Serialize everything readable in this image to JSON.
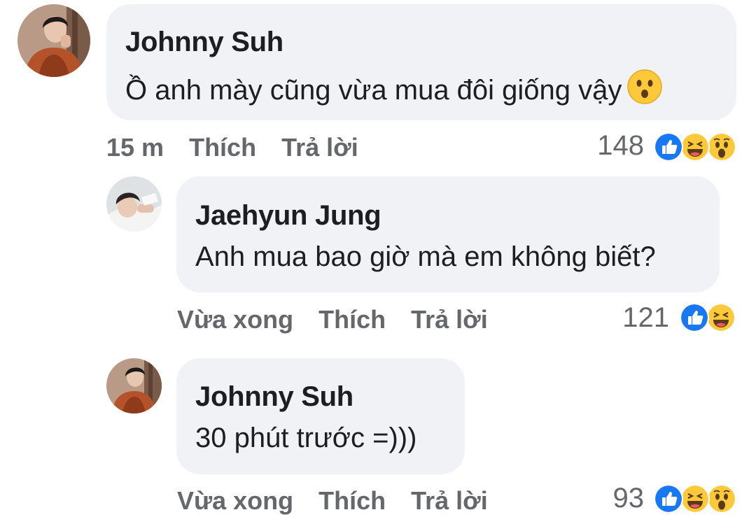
{
  "comments": [
    {
      "author": "Johnny Suh",
      "text": "Ồ anh mày cũng vừa mua đôi giống vậy",
      "inline_emoji": "hushed-face-emoji",
      "time": "15 m",
      "like_label": "Thích",
      "reply_label": "Trả lời",
      "reaction_count": "148",
      "reactions": [
        "like",
        "haha",
        "wow"
      ]
    },
    {
      "author": "Jaehyun Jung",
      "text": "Anh mua bao giờ mà em không biết?",
      "time": "Vừa xong",
      "like_label": "Thích",
      "reply_label": "Trả lời",
      "reaction_count": "121",
      "reactions": [
        "like",
        "haha"
      ]
    },
    {
      "author": "Johnny Suh",
      "text": "30 phút trước =)))",
      "time": "Vừa xong",
      "like_label": "Thích",
      "reply_label": "Trả lời",
      "reaction_count": "93",
      "reactions": [
        "like",
        "haha",
        "wow"
      ]
    }
  ],
  "colors": {
    "bubble": "#f0f2f5",
    "meta_text": "#65676b",
    "like_blue": "#1877f2",
    "emoji_yellow": "#fcc93b"
  }
}
